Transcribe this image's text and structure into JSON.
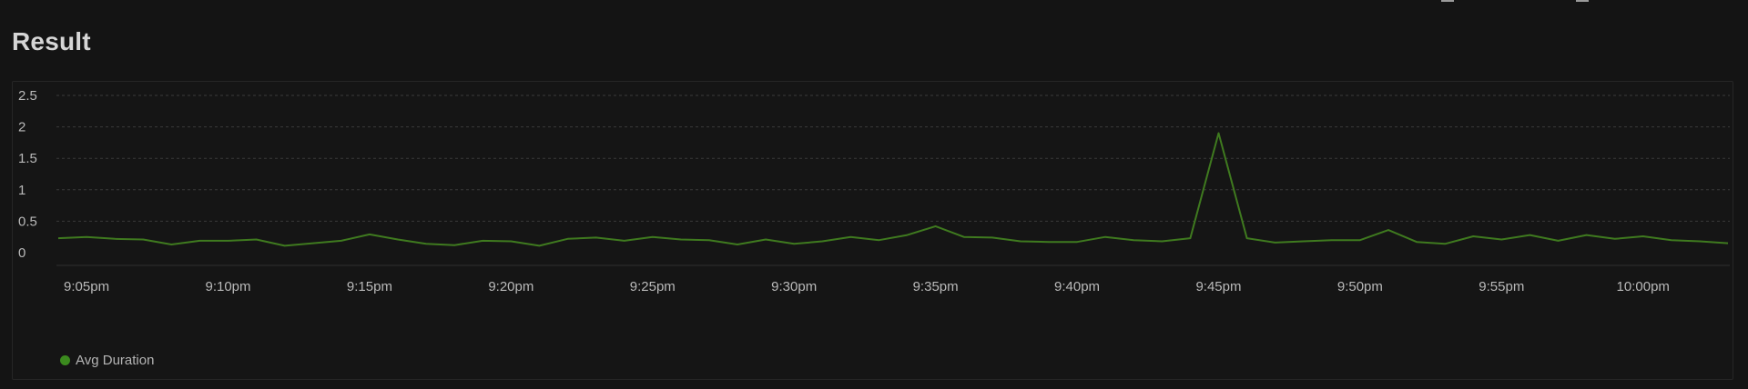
{
  "page": {
    "title": "Result"
  },
  "colors": {
    "background": "#141414",
    "grid": "#3a3a3a",
    "axis_text": "#b9b9b9",
    "series_line": "#3f7a1f",
    "legend_dot": "#3b8a1e"
  },
  "chart_data": {
    "type": "line",
    "title": "",
    "xlabel": "",
    "ylabel": "",
    "ylim": [
      0,
      2.5
    ],
    "yticks": [
      0,
      0.5,
      1,
      1.5,
      2,
      2.5
    ],
    "ytick_labels": [
      "0",
      "0.5",
      "1",
      "1.5",
      "2",
      "2.5"
    ],
    "x_start": "9:04pm",
    "x_end": "10:03pm",
    "xticks": [
      "9:05pm",
      "9:10pm",
      "9:15pm",
      "9:20pm",
      "9:25pm",
      "9:30pm",
      "9:35pm",
      "9:40pm",
      "9:45pm",
      "9:50pm",
      "9:55pm",
      "10:00pm"
    ],
    "grid": true,
    "legend_position": "bottom-left",
    "series": [
      {
        "name": "Avg Duration",
        "x": [
          "9:04pm",
          "9:05pm",
          "9:06pm",
          "9:07pm",
          "9:08pm",
          "9:09pm",
          "9:10pm",
          "9:11pm",
          "9:12pm",
          "9:13pm",
          "9:14pm",
          "9:15pm",
          "9:16pm",
          "9:17pm",
          "9:18pm",
          "9:19pm",
          "9:20pm",
          "9:21pm",
          "9:22pm",
          "9:23pm",
          "9:24pm",
          "9:25pm",
          "9:26pm",
          "9:27pm",
          "9:28pm",
          "9:29pm",
          "9:30pm",
          "9:31pm",
          "9:32pm",
          "9:33pm",
          "9:34pm",
          "9:35pm",
          "9:36pm",
          "9:37pm",
          "9:38pm",
          "9:39pm",
          "9:40pm",
          "9:41pm",
          "9:42pm",
          "9:43pm",
          "9:44pm",
          "9:45pm",
          "9:46pm",
          "9:47pm",
          "9:48pm",
          "9:49pm",
          "9:50pm",
          "9:51pm",
          "9:52pm",
          "9:53pm",
          "9:54pm",
          "9:55pm",
          "9:56pm",
          "9:57pm",
          "9:58pm",
          "9:59pm",
          "10:00pm",
          "10:01pm",
          "10:02pm",
          "10:03pm"
        ],
        "values": [
          0.23,
          0.25,
          0.22,
          0.21,
          0.13,
          0.19,
          0.19,
          0.21,
          0.11,
          0.15,
          0.19,
          0.29,
          0.21,
          0.14,
          0.12,
          0.19,
          0.18,
          0.11,
          0.22,
          0.24,
          0.19,
          0.25,
          0.21,
          0.2,
          0.13,
          0.21,
          0.14,
          0.18,
          0.25,
          0.2,
          0.28,
          0.42,
          0.25,
          0.24,
          0.18,
          0.17,
          0.17,
          0.25,
          0.2,
          0.18,
          0.23,
          1.9,
          0.23,
          0.16,
          0.18,
          0.2,
          0.2,
          0.36,
          0.17,
          0.14,
          0.26,
          0.21,
          0.28,
          0.19,
          0.28,
          0.22,
          0.26,
          0.2,
          0.18,
          0.15
        ]
      }
    ]
  }
}
